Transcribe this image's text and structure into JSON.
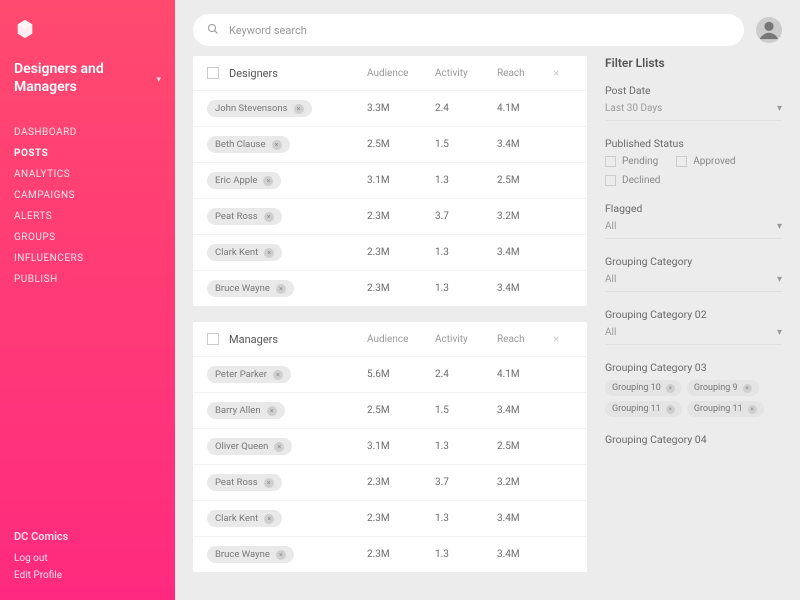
{
  "sidebar": {
    "workspace": "Designers and Managers",
    "nav": [
      "DASHBOARD",
      "POSTS",
      "ANALYTICS",
      "CAMPAIGNS",
      "ALERTS",
      "GROUPS",
      "INFLUENCERS",
      "PUBLISH"
    ],
    "active_index": 1,
    "footer": {
      "company": "DC Comics",
      "logout": "Log out",
      "edit": "Edit Profile"
    }
  },
  "search": {
    "placeholder": "Keyword search"
  },
  "tables": [
    {
      "title": "Designers",
      "cols": [
        "Audience",
        "Activity",
        "Reach"
      ],
      "rows": [
        {
          "name": "John Stevensons",
          "audience": "3.3M",
          "activity": "2.4",
          "reach": "4.1M"
        },
        {
          "name": "Beth Clause",
          "audience": "2.5M",
          "activity": "1.5",
          "reach": "3.4M"
        },
        {
          "name": "Eric Apple",
          "audience": "3.1M",
          "activity": "1.3",
          "reach": "2.5M"
        },
        {
          "name": "Peat Ross",
          "audience": "2.3M",
          "activity": "3.7",
          "reach": "3.2M"
        },
        {
          "name": "Clark Kent",
          "audience": "2.3M",
          "activity": "1.3",
          "reach": "3.4M"
        },
        {
          "name": "Bruce Wayne",
          "audience": "2.3M",
          "activity": "1.3",
          "reach": "3.4M"
        }
      ]
    },
    {
      "title": "Managers",
      "cols": [
        "Audience",
        "Activity",
        "Reach"
      ],
      "rows": [
        {
          "name": "Peter Parker",
          "audience": "5.6M",
          "activity": "2.4",
          "reach": "4.1M"
        },
        {
          "name": "Barry Allen",
          "audience": "2.5M",
          "activity": "1.5",
          "reach": "3.4M"
        },
        {
          "name": "Oliver Queen",
          "audience": "3.1M",
          "activity": "1.3",
          "reach": "2.5M"
        },
        {
          "name": "Peat Ross",
          "audience": "2.3M",
          "activity": "3.7",
          "reach": "3.2M"
        },
        {
          "name": "Clark Kent",
          "audience": "2.3M",
          "activity": "1.3",
          "reach": "3.4M"
        },
        {
          "name": "Bruce Wayne",
          "audience": "2.3M",
          "activity": "1.3",
          "reach": "3.4M"
        }
      ]
    }
  ],
  "filters": {
    "title": "Filter Llists",
    "post_date": {
      "label": "Post Date",
      "value": "Last 30 Days"
    },
    "published": {
      "label": "Published Status",
      "options": [
        "Pending",
        "Approved",
        "Declined"
      ]
    },
    "flagged": {
      "label": "Flagged",
      "value": "All"
    },
    "gc1": {
      "label": "Grouping Category",
      "value": "All"
    },
    "gc2": {
      "label": "Grouping Category 02",
      "value": "All"
    },
    "gc3": {
      "label": "Grouping Category 03",
      "chips": [
        "Grouping 10",
        "Grouping 9",
        "Grouping 11",
        "Grouping 11"
      ]
    },
    "gc4": {
      "label": "Grouping Category 04"
    }
  }
}
